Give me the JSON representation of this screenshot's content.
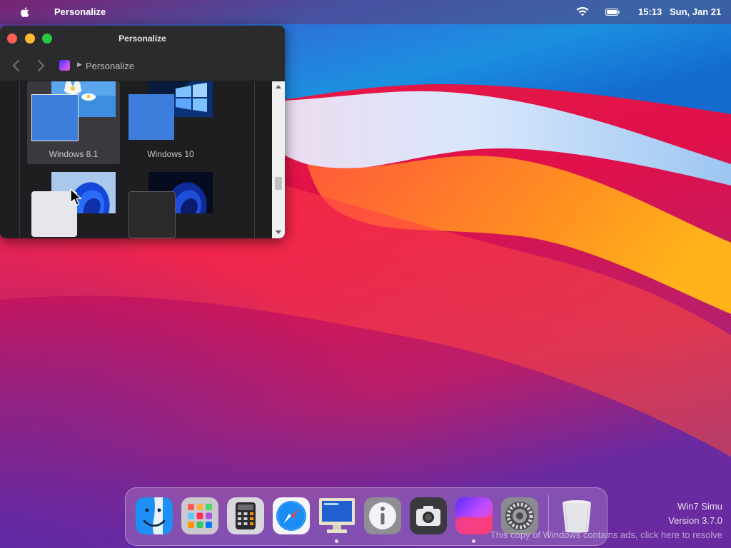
{
  "menubar": {
    "app_name": "Personalize",
    "time": "15:13",
    "date": "Sun, Jan 21",
    "icons": [
      "apple-icon",
      "wifi-icon",
      "battery-icon"
    ]
  },
  "window": {
    "title": "Personalize",
    "breadcrumb": {
      "icon": "personalize-icon",
      "label": "Personalize"
    },
    "tiles": [
      {
        "label": "Windows 8.1",
        "selected": true
      },
      {
        "label": "Windows 10",
        "selected": false
      },
      {
        "label": "",
        "selected": false
      },
      {
        "label": "",
        "selected": false
      }
    ]
  },
  "dock": {
    "items": [
      {
        "name": "finder",
        "running": false
      },
      {
        "name": "launchpad",
        "running": false
      },
      {
        "name": "calculator",
        "running": false
      },
      {
        "name": "safari",
        "running": false
      },
      {
        "name": "monitor",
        "running": true
      },
      {
        "name": "info",
        "running": false
      },
      {
        "name": "camera",
        "running": false
      },
      {
        "name": "personalize",
        "running": true
      },
      {
        "name": "system-settings",
        "running": false
      },
      {
        "name": "trash",
        "running": false
      }
    ]
  },
  "watermark": {
    "line1": "Win7 Simu",
    "line2": "Version 3.7.0",
    "line3": "This copy of Windows contains ads, click here to resolve"
  },
  "colors": {
    "accent_blue": "#3d7ddb",
    "window_bg": "#232326",
    "close": "#fe5f57",
    "minimize": "#febc2e",
    "maximize": "#28c840"
  }
}
